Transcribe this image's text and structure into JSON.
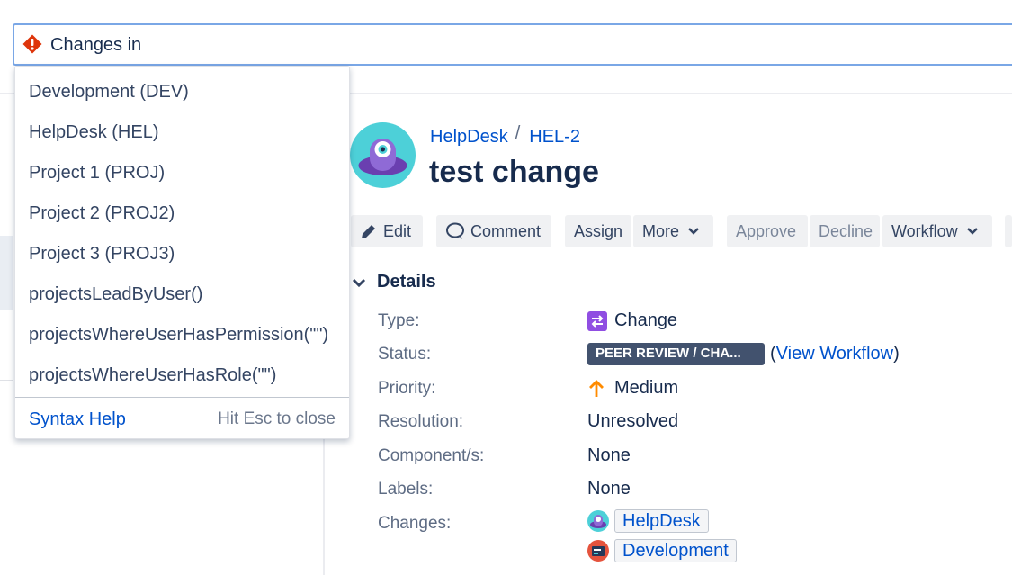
{
  "search": {
    "value": "Changes in"
  },
  "dropdown": {
    "items": [
      "Development (DEV)",
      "HelpDesk (HEL)",
      "Project 1 (PROJ)",
      "Project 2 (PROJ2)",
      "Project 3 (PROJ3)",
      "projectsLeadByUser()",
      "projectsWhereUserHasPermission(\"\")",
      "projectsWhereUserHasRole(\"\")"
    ],
    "syntax_help": "Syntax Help",
    "esc_hint": "Hit Esc to close"
  },
  "issue": {
    "breadcrumb_project": "HelpDesk",
    "breadcrumb_separator": "/",
    "breadcrumb_key": "HEL-2",
    "title": "test change"
  },
  "toolbar": {
    "edit": "Edit",
    "comment": "Comment",
    "assign": "Assign",
    "more": "More",
    "approve": "Approve",
    "decline": "Decline",
    "workflow": "Workflow"
  },
  "details": {
    "heading": "Details",
    "type_label": "Type:",
    "type_value": "Change",
    "status_label": "Status:",
    "status_value": "PEER REVIEW / CHA...",
    "view_workflow_open": "(",
    "view_workflow": "View Workflow",
    "view_workflow_close": ")",
    "priority_label": "Priority:",
    "priority_value": "Medium",
    "resolution_label": "Resolution:",
    "resolution_value": "Unresolved",
    "components_label": "Component/s:",
    "components_value": "None",
    "labels_label": "Labels:",
    "labels_value": "None",
    "changes_label": "Changes:",
    "changes_values": [
      "HelpDesk",
      "Development"
    ]
  },
  "colors": {
    "link": "#0052cc",
    "status_lozenge": "#42526e",
    "priority_arrow": "#ff8b00",
    "change_icon": "#904ee2",
    "warning_icon": "#de350b"
  }
}
